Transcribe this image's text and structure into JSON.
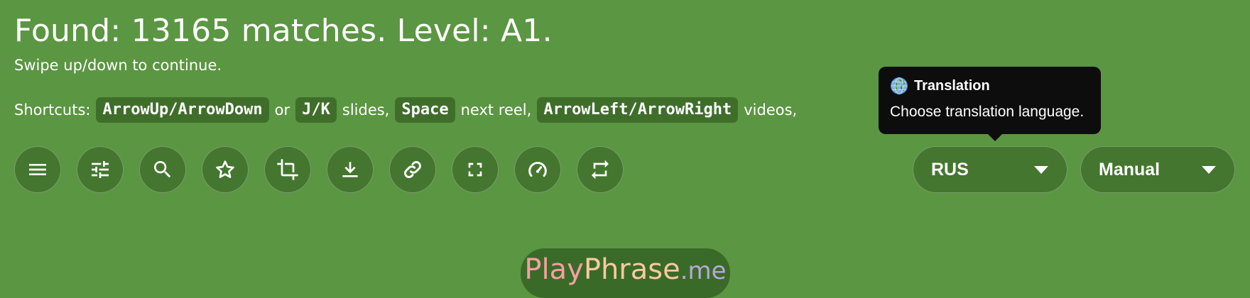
{
  "header": {
    "title": "Found: 13165 matches. Level: A1.",
    "subtitle": "Swipe up/down to continue."
  },
  "shortcuts": {
    "label": "Shortcuts:",
    "key_updown": "ArrowUp/ArrowDown",
    "or": "or",
    "key_jk": "J/K",
    "slides": "slides,",
    "key_space": "Space",
    "next_reel": "next reel,",
    "key_leftright": "ArrowLeft/ArrowRight",
    "videos": "videos,"
  },
  "toolbar": {
    "buttons": [
      {
        "icon": "menu-icon"
      },
      {
        "icon": "tune-icon"
      },
      {
        "icon": "search-icon"
      },
      {
        "icon": "star-icon"
      },
      {
        "icon": "crop-icon"
      },
      {
        "icon": "download-icon"
      },
      {
        "icon": "link-icon"
      },
      {
        "icon": "fullscreen-icon"
      },
      {
        "icon": "speed-icon"
      },
      {
        "icon": "repeat-icon"
      }
    ]
  },
  "translation_select": {
    "value": "RUS"
  },
  "mode_select": {
    "value": "Manual"
  },
  "tooltip": {
    "icon": "globe-icon",
    "title": "Translation",
    "body": "Choose translation language."
  },
  "brand": {
    "part1": "Play",
    "part2": "Phrase",
    "part3": ".me"
  },
  "colors": {
    "background": "#5b9642",
    "button_bg": "#44762f",
    "kbd_bg": "#3f6e2b",
    "tooltip_bg": "#0d0d0d"
  }
}
